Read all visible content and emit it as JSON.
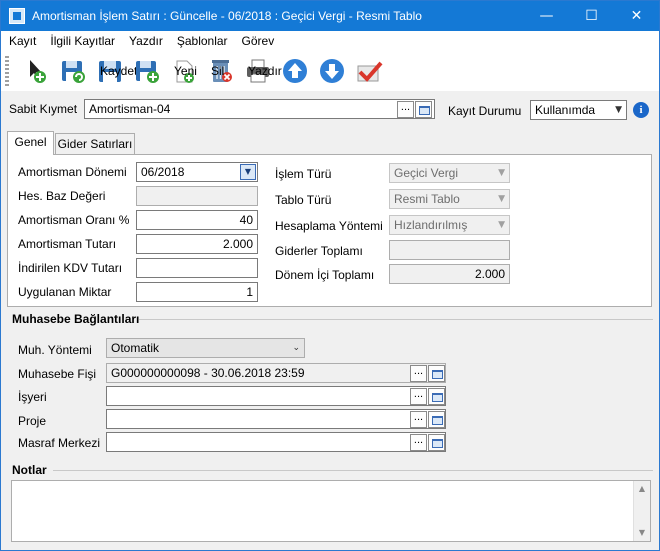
{
  "window": {
    "title": "Amortisman İşlem Satırı : Güncelle - 06/2018 : Geçici Vergi - Resmi Tablo",
    "minimize": "—",
    "maximize": "☐",
    "close": "✕"
  },
  "menu": [
    "Kayıt",
    "İlgili Kayıtlar",
    "Yazdır",
    "Şablonlar",
    "Görev"
  ],
  "toolbar": {
    "save_label": "Kaydet",
    "new_label": "Yeni",
    "delete_label": "Sil",
    "print_label": "Yazdır"
  },
  "header": {
    "asset_label": "Sabit Kıymet",
    "asset_value": "Amortisman-04",
    "status_label": "Kayıt Durumu",
    "status_value": "Kullanımda",
    "dots": "..."
  },
  "tabs": [
    "Genel",
    "Gider Satırları"
  ],
  "general": {
    "period_label": "Amortisman Dönemi",
    "period_value": "06/2018",
    "base_label": "Hes. Baz Değeri",
    "base_value": "",
    "rate_label": "Amortisman Oranı %",
    "rate_value": "40",
    "amount_label": "Amortisman Tutarı",
    "amount_value": "2.000",
    "kdv_label": "İndirilen KDV Tutarı",
    "kdv_value": "",
    "qty_label": "Uygulanan Miktar",
    "qty_value": "1",
    "optype_label": "İşlem Türü",
    "optype_value": "Geçici Vergi",
    "tabletype_label": "Tablo Türü",
    "tabletype_value": "Resmi Tablo",
    "calcmethod_label": "Hesaplama Yöntemi",
    "calcmethod_value": "Hızlandırılmış",
    "expense_total_label": "Giderler Toplamı",
    "expense_total_value": "",
    "period_total_label": "Dönem İçi Toplamı",
    "period_total_value": "2.000"
  },
  "accounting": {
    "section_title": "Muhasebe Bağlantıları",
    "method_label": "Muh. Yöntemi",
    "method_value": "Otomatik",
    "voucher_label": "Muhasebe Fişi",
    "voucher_value": "G000000000098 - 30.06.2018 23:59",
    "workplace_label": "İşyeri",
    "workplace_value": "",
    "project_label": "Proje",
    "project_value": "",
    "costcenter_label": "Masraf Merkezi",
    "costcenter_value": ""
  },
  "notes": {
    "section_title": "Notlar",
    "value": ""
  },
  "icons": {
    "new_record": "new-record-icon",
    "save_new": "save-and-new-icon",
    "save": "save-icon",
    "save_add": "save-add-icon",
    "new": "new-document-icon",
    "delete": "delete-icon",
    "print": "printer-icon",
    "up": "arrow-up-icon",
    "down": "arrow-down-icon",
    "approve": "approve-icon",
    "info": "info-icon"
  }
}
